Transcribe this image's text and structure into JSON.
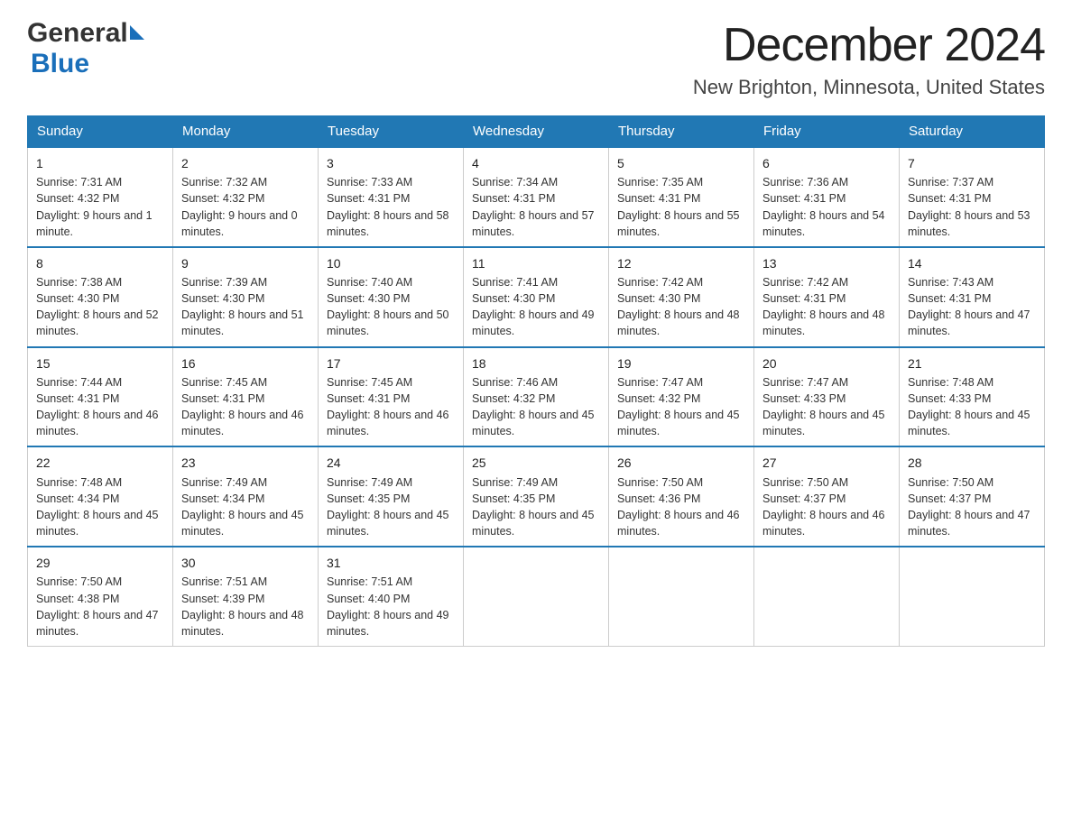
{
  "header": {
    "logo_general": "General",
    "logo_blue": "Blue",
    "title": "December 2024",
    "subtitle": "New Brighton, Minnesota, United States"
  },
  "calendar": {
    "days": [
      "Sunday",
      "Monday",
      "Tuesday",
      "Wednesday",
      "Thursday",
      "Friday",
      "Saturday"
    ],
    "weeks": [
      [
        {
          "day": 1,
          "sunrise": "7:31 AM",
          "sunset": "4:32 PM",
          "daylight": "9 hours and 1 minute."
        },
        {
          "day": 2,
          "sunrise": "7:32 AM",
          "sunset": "4:32 PM",
          "daylight": "9 hours and 0 minutes."
        },
        {
          "day": 3,
          "sunrise": "7:33 AM",
          "sunset": "4:31 PM",
          "daylight": "8 hours and 58 minutes."
        },
        {
          "day": 4,
          "sunrise": "7:34 AM",
          "sunset": "4:31 PM",
          "daylight": "8 hours and 57 minutes."
        },
        {
          "day": 5,
          "sunrise": "7:35 AM",
          "sunset": "4:31 PM",
          "daylight": "8 hours and 55 minutes."
        },
        {
          "day": 6,
          "sunrise": "7:36 AM",
          "sunset": "4:31 PM",
          "daylight": "8 hours and 54 minutes."
        },
        {
          "day": 7,
          "sunrise": "7:37 AM",
          "sunset": "4:31 PM",
          "daylight": "8 hours and 53 minutes."
        }
      ],
      [
        {
          "day": 8,
          "sunrise": "7:38 AM",
          "sunset": "4:30 PM",
          "daylight": "8 hours and 52 minutes."
        },
        {
          "day": 9,
          "sunrise": "7:39 AM",
          "sunset": "4:30 PM",
          "daylight": "8 hours and 51 minutes."
        },
        {
          "day": 10,
          "sunrise": "7:40 AM",
          "sunset": "4:30 PM",
          "daylight": "8 hours and 50 minutes."
        },
        {
          "day": 11,
          "sunrise": "7:41 AM",
          "sunset": "4:30 PM",
          "daylight": "8 hours and 49 minutes."
        },
        {
          "day": 12,
          "sunrise": "7:42 AM",
          "sunset": "4:30 PM",
          "daylight": "8 hours and 48 minutes."
        },
        {
          "day": 13,
          "sunrise": "7:42 AM",
          "sunset": "4:31 PM",
          "daylight": "8 hours and 48 minutes."
        },
        {
          "day": 14,
          "sunrise": "7:43 AM",
          "sunset": "4:31 PM",
          "daylight": "8 hours and 47 minutes."
        }
      ],
      [
        {
          "day": 15,
          "sunrise": "7:44 AM",
          "sunset": "4:31 PM",
          "daylight": "8 hours and 46 minutes."
        },
        {
          "day": 16,
          "sunrise": "7:45 AM",
          "sunset": "4:31 PM",
          "daylight": "8 hours and 46 minutes."
        },
        {
          "day": 17,
          "sunrise": "7:45 AM",
          "sunset": "4:31 PM",
          "daylight": "8 hours and 46 minutes."
        },
        {
          "day": 18,
          "sunrise": "7:46 AM",
          "sunset": "4:32 PM",
          "daylight": "8 hours and 45 minutes."
        },
        {
          "day": 19,
          "sunrise": "7:47 AM",
          "sunset": "4:32 PM",
          "daylight": "8 hours and 45 minutes."
        },
        {
          "day": 20,
          "sunrise": "7:47 AM",
          "sunset": "4:33 PM",
          "daylight": "8 hours and 45 minutes."
        },
        {
          "day": 21,
          "sunrise": "7:48 AM",
          "sunset": "4:33 PM",
          "daylight": "8 hours and 45 minutes."
        }
      ],
      [
        {
          "day": 22,
          "sunrise": "7:48 AM",
          "sunset": "4:34 PM",
          "daylight": "8 hours and 45 minutes."
        },
        {
          "day": 23,
          "sunrise": "7:49 AM",
          "sunset": "4:34 PM",
          "daylight": "8 hours and 45 minutes."
        },
        {
          "day": 24,
          "sunrise": "7:49 AM",
          "sunset": "4:35 PM",
          "daylight": "8 hours and 45 minutes."
        },
        {
          "day": 25,
          "sunrise": "7:49 AM",
          "sunset": "4:35 PM",
          "daylight": "8 hours and 45 minutes."
        },
        {
          "day": 26,
          "sunrise": "7:50 AM",
          "sunset": "4:36 PM",
          "daylight": "8 hours and 46 minutes."
        },
        {
          "day": 27,
          "sunrise": "7:50 AM",
          "sunset": "4:37 PM",
          "daylight": "8 hours and 46 minutes."
        },
        {
          "day": 28,
          "sunrise": "7:50 AM",
          "sunset": "4:37 PM",
          "daylight": "8 hours and 47 minutes."
        }
      ],
      [
        {
          "day": 29,
          "sunrise": "7:50 AM",
          "sunset": "4:38 PM",
          "daylight": "8 hours and 47 minutes."
        },
        {
          "day": 30,
          "sunrise": "7:51 AM",
          "sunset": "4:39 PM",
          "daylight": "8 hours and 48 minutes."
        },
        {
          "day": 31,
          "sunrise": "7:51 AM",
          "sunset": "4:40 PM",
          "daylight": "8 hours and 49 minutes."
        },
        null,
        null,
        null,
        null
      ]
    ]
  }
}
